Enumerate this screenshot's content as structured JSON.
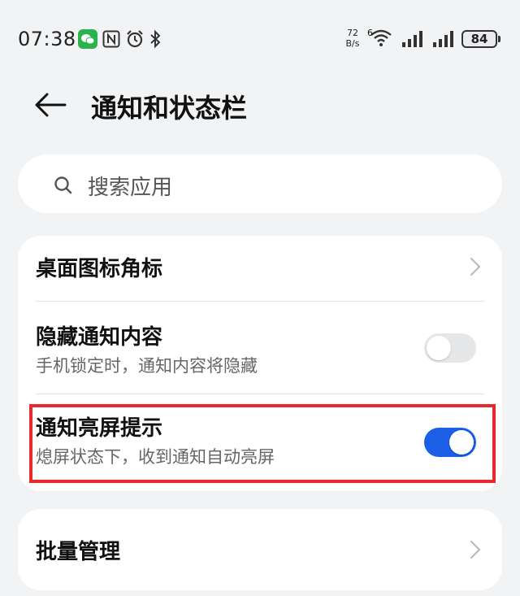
{
  "status_bar": {
    "time": "07:38",
    "net_speed_value": "72",
    "net_speed_unit": "B/s",
    "wifi_label": "6",
    "battery": "84"
  },
  "header": {
    "title": "通知和状态栏"
  },
  "search": {
    "placeholder": "搜索应用"
  },
  "settings": {
    "badge_row": {
      "title": "桌面图标角标"
    },
    "hide_content_row": {
      "title": "隐藏通知内容",
      "subtitle": "手机锁定时，通知内容将隐藏",
      "enabled": false
    },
    "wake_screen_row": {
      "title": "通知亮屏提示",
      "subtitle": "熄屏状态下，收到通知自动亮屏",
      "enabled": true
    },
    "batch_row": {
      "title": "批量管理"
    }
  },
  "colors": {
    "accent": "#1a5fe6",
    "highlight": "#e8282b",
    "wechat": "#2ab34a"
  }
}
